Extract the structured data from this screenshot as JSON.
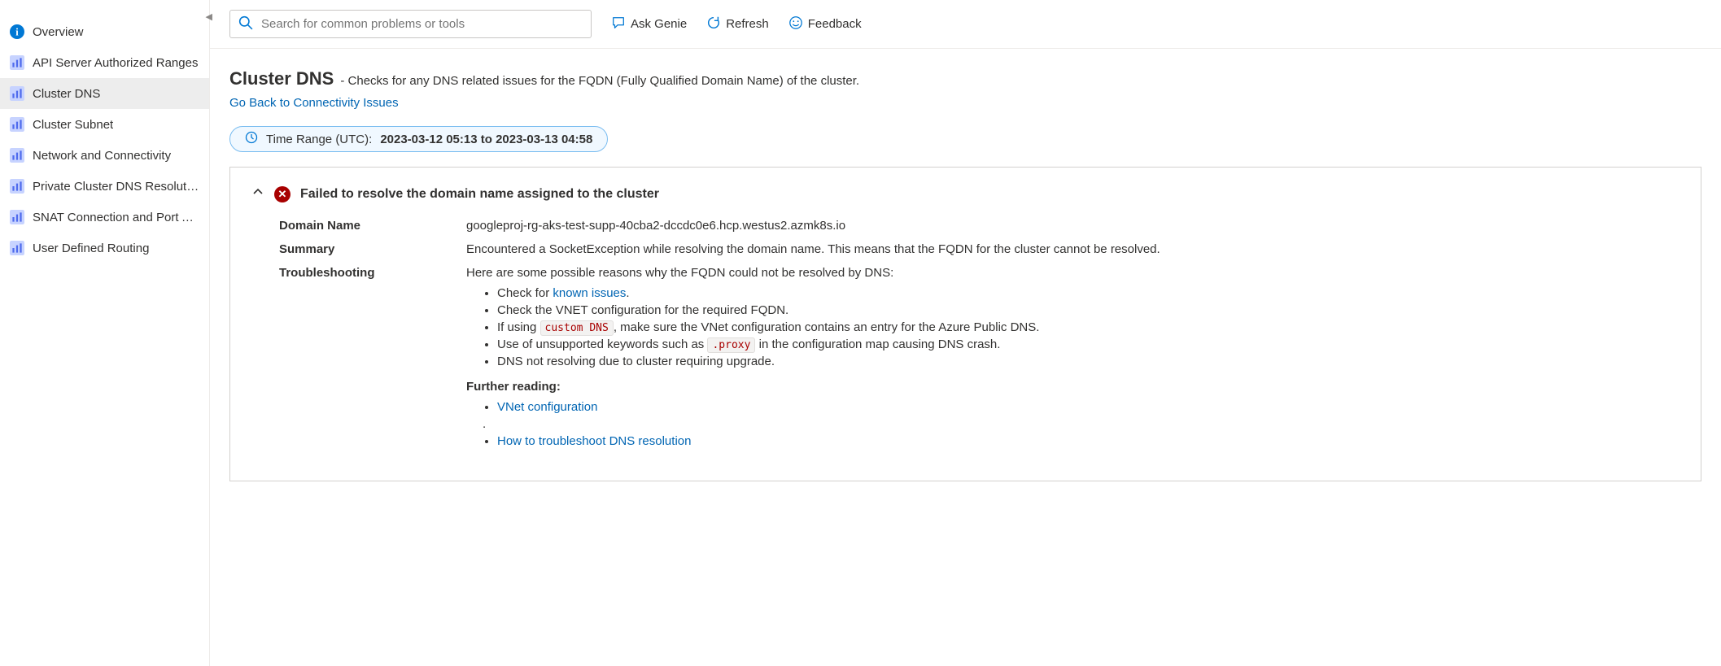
{
  "sidebar": {
    "overview_label": "Overview",
    "items": [
      {
        "label": "API Server Authorized Ranges"
      },
      {
        "label": "Cluster DNS",
        "active": true
      },
      {
        "label": "Cluster Subnet"
      },
      {
        "label": "Network and Connectivity"
      },
      {
        "label": "Private Cluster DNS Resolutio..."
      },
      {
        "label": "SNAT Connection and Port Al..."
      },
      {
        "label": "User Defined Routing"
      }
    ]
  },
  "toolbar": {
    "search_placeholder": "Search for common problems or tools",
    "ask_genie": "Ask Genie",
    "refresh": "Refresh",
    "feedback": "Feedback"
  },
  "page": {
    "title": "Cluster DNS",
    "subtitle": " -  Checks for any DNS related issues for the FQDN (Fully Qualified Domain Name) of the cluster.",
    "back_link": "Go Back to Connectivity Issues",
    "time_prefix": "Time Range (UTC): ",
    "time_value": "2023-03-12 05:13 to 2023-03-13 04:58"
  },
  "panel": {
    "header": "Failed to resolve the domain name assigned to the cluster",
    "rows": {
      "domain_label": "Domain Name",
      "domain_value": "googleproj-rg-aks-test-supp-40cba2-dccdc0e6.hcp.westus2.azmk8s.io",
      "summary_label": "Summary",
      "summary_value": "Encountered a SocketException while resolving the domain name. This means that the FQDN for the cluster cannot be resolved.",
      "trouble_label": "Troubleshooting",
      "trouble_intro": "Here are some possible reasons why the FQDN could not be resolved by DNS:",
      "bullet1_a": "Check for ",
      "bullet1_link": "known issues",
      "bullet1_b": ".",
      "bullet2": "Check the VNET configuration for the required FQDN.",
      "bullet3_a": "If using ",
      "bullet3_code": "custom DNS",
      "bullet3_b": ", make sure the VNet configuration contains an entry for the Azure Public DNS.",
      "bullet4_a": "Use of unsupported keywords such as ",
      "bullet4_code": ".proxy",
      "bullet4_b": " in the configuration map causing DNS crash.",
      "bullet5": "DNS not resolving due to cluster requiring upgrade.",
      "further": "Further reading:",
      "read1": "VNet configuration",
      "read_dot": ".",
      "read2": "How to troubleshoot DNS resolution"
    }
  }
}
